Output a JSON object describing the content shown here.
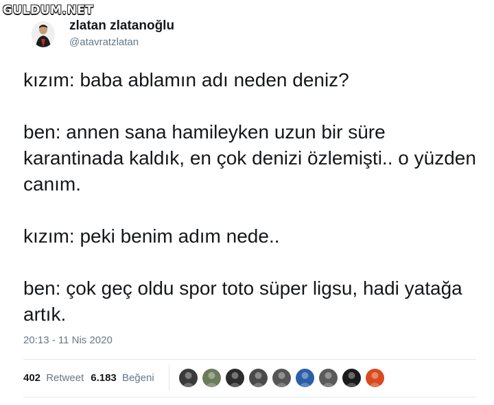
{
  "watermark": "GULDUM.NET",
  "author": {
    "display_name": "zlatan zlatanoğlu",
    "handle": "@atavratzlatan"
  },
  "tweet": {
    "lines": [
      "kızım: baba ablamın adı neden deniz?",
      "ben: annen sana hamileyken uzun bir süre karantinada kaldık, en çok denizi özlemişti.. o yüzden canım.",
      "kızım: peki benim adım nede..",
      "ben: çok geç oldu spor toto süper ligsu, hadi yatağa artık."
    ],
    "timestamp": "20:13 - 11 Nis 2020"
  },
  "stats": {
    "retweet_count": "402",
    "retweet_label": "Retweet",
    "like_count": "6.183",
    "like_label": "Beğeni"
  },
  "likers": [
    {
      "name": "liker-avatar-1",
      "color": "#3a3a3a"
    },
    {
      "name": "liker-avatar-2",
      "color": "#6b7c5a"
    },
    {
      "name": "liker-avatar-3",
      "color": "#2c2c2c"
    },
    {
      "name": "liker-avatar-4",
      "color": "#4a4a4a"
    },
    {
      "name": "liker-avatar-5",
      "color": "#555555"
    },
    {
      "name": "liker-avatar-6",
      "color": "#2a5fa8"
    },
    {
      "name": "liker-avatar-7",
      "color": "#5a5a5a"
    },
    {
      "name": "liker-avatar-8",
      "color": "#1a1a1a"
    },
    {
      "name": "liker-avatar-9",
      "color": "#d94a1f"
    }
  ]
}
